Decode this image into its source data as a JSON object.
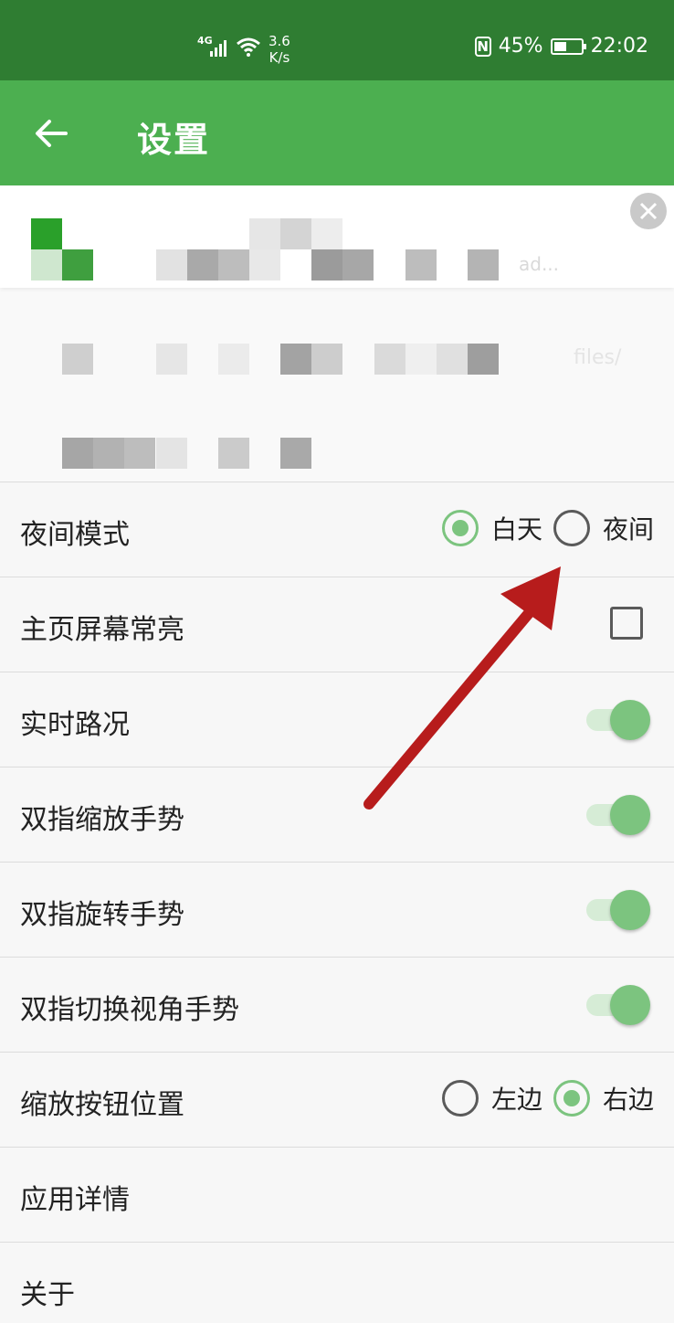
{
  "status_bar": {
    "network": "4G",
    "speed_value": "3.6",
    "speed_unit": "K/s",
    "nfc": "N",
    "battery": "45%",
    "battery_level": 0.45,
    "time": "22:02"
  },
  "app_bar": {
    "back_icon": "back-arrow-icon",
    "title": "设置"
  },
  "banner": {
    "faint_text_1": "ad...",
    "faint_text_2": "files/"
  },
  "settings": {
    "night_mode": {
      "label": "夜间模式",
      "options": [
        "白天",
        "夜间"
      ],
      "selected": "白天"
    },
    "screen_on": {
      "label": "主页屏幕常亮",
      "checked": false
    },
    "traffic": {
      "label": "实时路况",
      "on": true
    },
    "pinch_zoom": {
      "label": "双指缩放手势",
      "on": true
    },
    "rotate": {
      "label": "双指旋转手势",
      "on": true
    },
    "tilt": {
      "label": "双指切换视角手势",
      "on": true
    },
    "zoom_buttons": {
      "label": "缩放按钮位置",
      "options": [
        "左边",
        "右边"
      ],
      "selected": "右边"
    },
    "app_details": {
      "label": "应用详情"
    },
    "about": {
      "label": "关于"
    }
  },
  "colors": {
    "status_bar": "#2f7d32",
    "app_bar": "#4caf50",
    "accent": "#7cc47f",
    "annotation_arrow": "#b71c1c"
  }
}
